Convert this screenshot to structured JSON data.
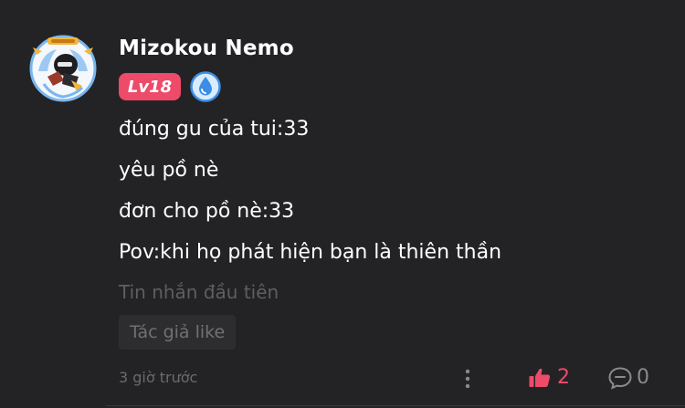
{
  "user": {
    "name": "Mizokou Nemo",
    "level_badge": "Lv18",
    "avatar_icon": "avatar-image",
    "verify_icon": "droplet-badge-icon"
  },
  "message": {
    "lines": [
      "đúng gu của tui:33",
      "yêu pồ nè",
      "đơn cho pồ nè:33",
      "Pov:khi họ phát hiện bạn là thiên thần"
    ],
    "first_message_label": "Tin nhắn đầu tiên",
    "author_like_label": "Tác giả like"
  },
  "footer": {
    "timestamp": "3 giờ trước",
    "like_count": "2",
    "comment_count": "0"
  },
  "colors": {
    "background": "#232325",
    "accent": "#ee4a6a",
    "verify_blue": "#3b8de6",
    "muted_text": "#6a6a6f"
  }
}
